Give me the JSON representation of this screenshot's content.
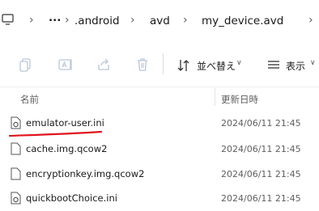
{
  "breadcrumb": {
    "items": [
      "...",
      ".android",
      "avd",
      "my_device.avd"
    ]
  },
  "toolbar": {
    "sort_label": "並べ替え",
    "view_label": "表示"
  },
  "columns": {
    "name": "名前",
    "modified": "更新日時"
  },
  "files": [
    {
      "name": "emulator-user.ini",
      "modified": "2024/06/11 21:45",
      "icon": "settings-file-icon"
    },
    {
      "name": "cache.img.qcow2",
      "modified": "2024/06/11 21:45",
      "icon": "file-icon"
    },
    {
      "name": "encryptionkey.img.qcow2",
      "modified": "2024/06/11 21:45",
      "icon": "file-icon"
    },
    {
      "name": "quickbootChoice.ini",
      "modified": "2024/06/11 21:45",
      "icon": "settings-file-icon"
    }
  ],
  "annotation": {
    "underline_color": "#e0141e"
  }
}
